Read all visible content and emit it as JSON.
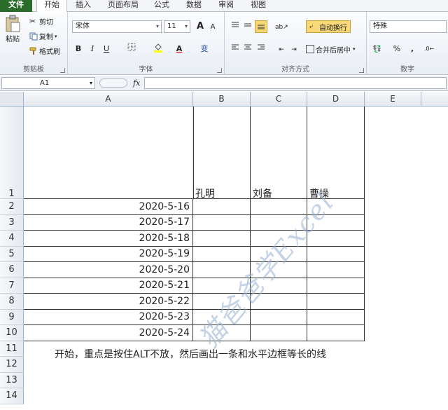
{
  "tabs": [
    "文件",
    "开始",
    "插入",
    "页面布局",
    "公式",
    "数据",
    "审阅",
    "视图"
  ],
  "clipboard": {
    "paste": "粘贴",
    "cut": "剪切",
    "copy": "复制",
    "format_painter": "格式刷",
    "label": "剪贴板"
  },
  "font": {
    "name": "宋体",
    "size": "11",
    "bold": "B",
    "italic": "I",
    "underline": "U",
    "label": "字体",
    "grow": "A",
    "shrink": "A",
    "phonetic": "变"
  },
  "alignment": {
    "wrap_text": "自动换行",
    "merge_center": "合并后居中",
    "label": "对齐方式"
  },
  "number": {
    "format": "特殊",
    "percent": "%",
    "comma": ",",
    "label": "数字"
  },
  "formula_bar": {
    "name_box": "A1",
    "fx": "fx",
    "value": ""
  },
  "columns": [
    "A",
    "B",
    "C",
    "D",
    "E"
  ],
  "rows": [
    "1",
    "2",
    "3",
    "4",
    "5",
    "6",
    "7",
    "8",
    "9",
    "10",
    "11",
    "12",
    "13",
    "14"
  ],
  "headers": [
    "孔明",
    "刘备",
    "曹操"
  ],
  "dates": [
    "2020-5-16",
    "2020-5-17",
    "2020-5-18",
    "2020-5-19",
    "2020-5-20",
    "2020-5-21",
    "2020-5-22",
    "2020-5-23",
    "2020-5-24"
  ],
  "note": "开始，重点是按住ALT不放，然后画出一条和水平边框等长的线",
  "watermark": "猫爸爸学Excel",
  "colors": {
    "file_tab": "#2a6c2a",
    "wrap_highlight": "#f8d877",
    "grid_line": "#dadcdd"
  }
}
